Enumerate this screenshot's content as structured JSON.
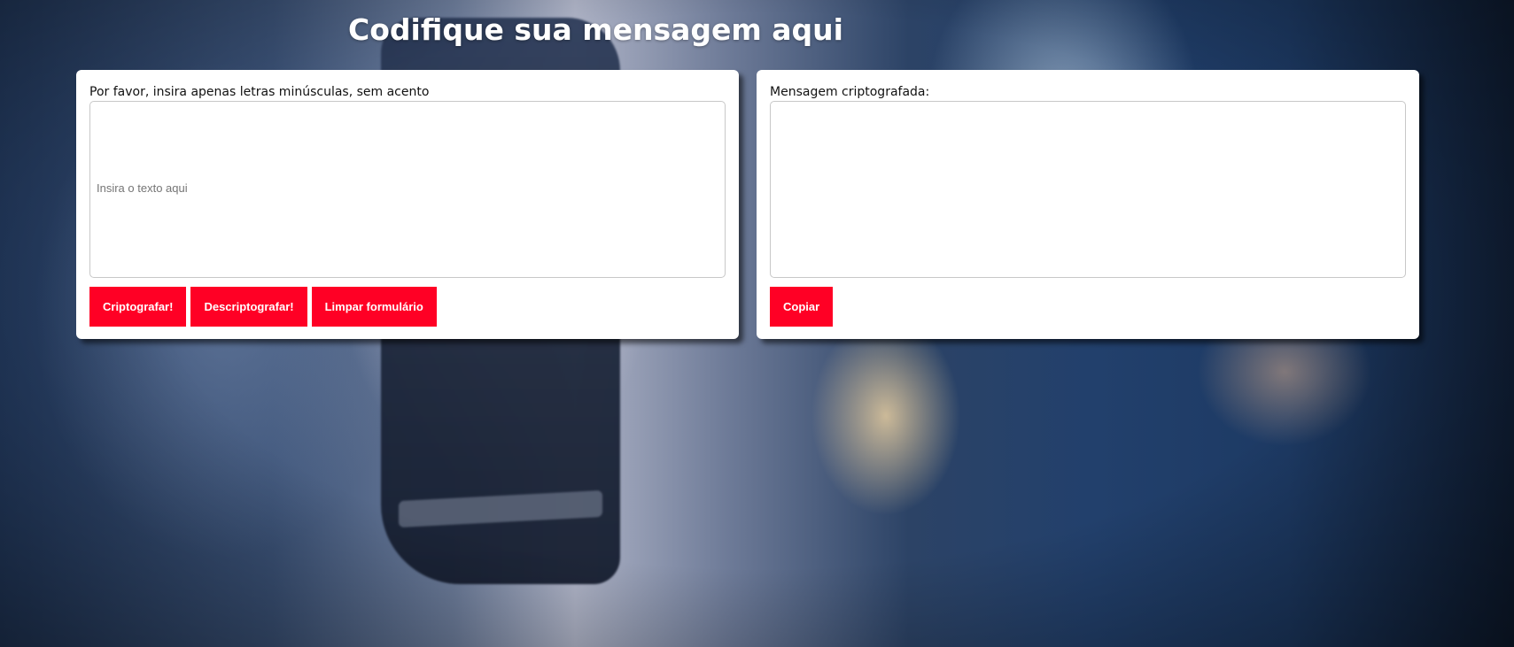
{
  "page": {
    "title": "Codifique sua mensagem aqui"
  },
  "input_panel": {
    "label": "Por favor, insira apenas letras minúsculas, sem acento",
    "textarea_placeholder": "Insira o texto aqui",
    "textarea_value": "",
    "buttons": {
      "encrypt": "Criptografar!",
      "decrypt": "Descriptografar!",
      "clear": "Limpar formulário"
    }
  },
  "output_panel": {
    "label": "Mensagem criptografada:",
    "textarea_value": "",
    "buttons": {
      "copy": "Copiar"
    }
  },
  "colors": {
    "button_bg": "#ff0025",
    "button_text": "#ffffff",
    "panel_bg": "#ffffff",
    "title_text": "#ffffff"
  }
}
